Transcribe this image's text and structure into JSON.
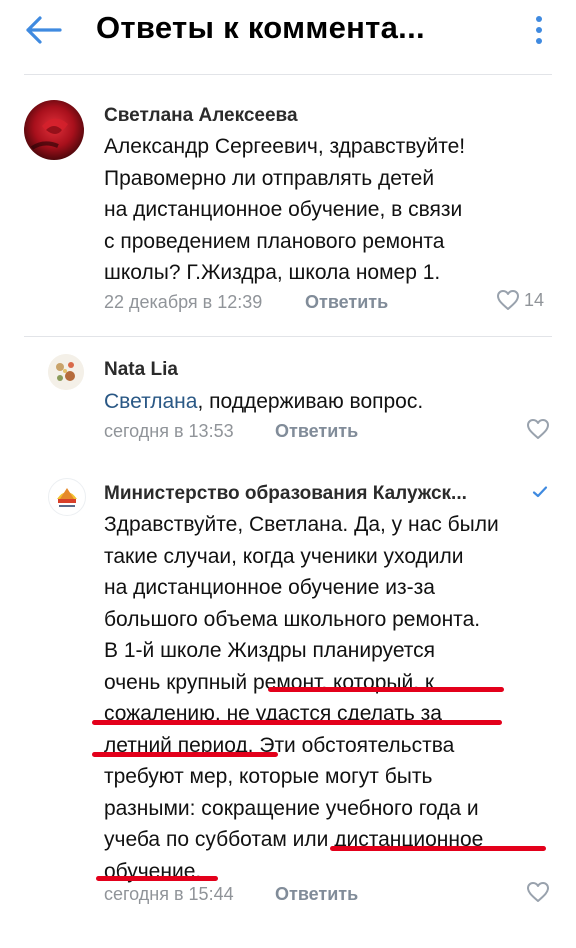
{
  "header": {
    "title": "Ответы к коммента...",
    "accent_color": "#3f8ae0"
  },
  "comments": [
    {
      "author": "Светлана Алексеева",
      "lines": [
        "Александр Сергеевич, здравствуйте!",
        "Правомерно ли отправлять детей",
        "на дистанционное обучение, в связи",
        "с проведением планового ремонта",
        "школы? Г.Жиздра, школа номер 1."
      ],
      "time": "22 декабря в 12:39",
      "reply_label": "Ответить",
      "likes": "14"
    },
    {
      "author": "Nata Lia",
      "mention": "Светлана",
      "text_rest": ", поддерживаю вопрос.",
      "time": "сегодня в 13:53",
      "reply_label": "Ответить"
    },
    {
      "author": "Министерство образования Калужск...",
      "verified": true,
      "lines": [
        "Здравствуйте, Светлана. Да, у нас были",
        "такие случаи, когда ученики уходили",
        "на дистанционное обучение из-за",
        "большого объема школьного ремонта.",
        "В 1-й школе Жиздры планируется",
        "очень крупный ремонт, который, к",
        "сожалению, не удастся сделать за",
        "летний период. Эти обстоятельства",
        "требуют мер, которые могут быть",
        "разными: сокращение учебного года и",
        "учеба по субботам или дистанционное",
        "обучение."
      ],
      "time": "сегодня в 15:44",
      "reply_label": "Ответить",
      "underline_color": "#e3001b"
    }
  ],
  "icons": {
    "back": "arrow-left-icon",
    "more": "more-vertical-icon",
    "like": "heart-icon",
    "verified": "check-icon"
  }
}
